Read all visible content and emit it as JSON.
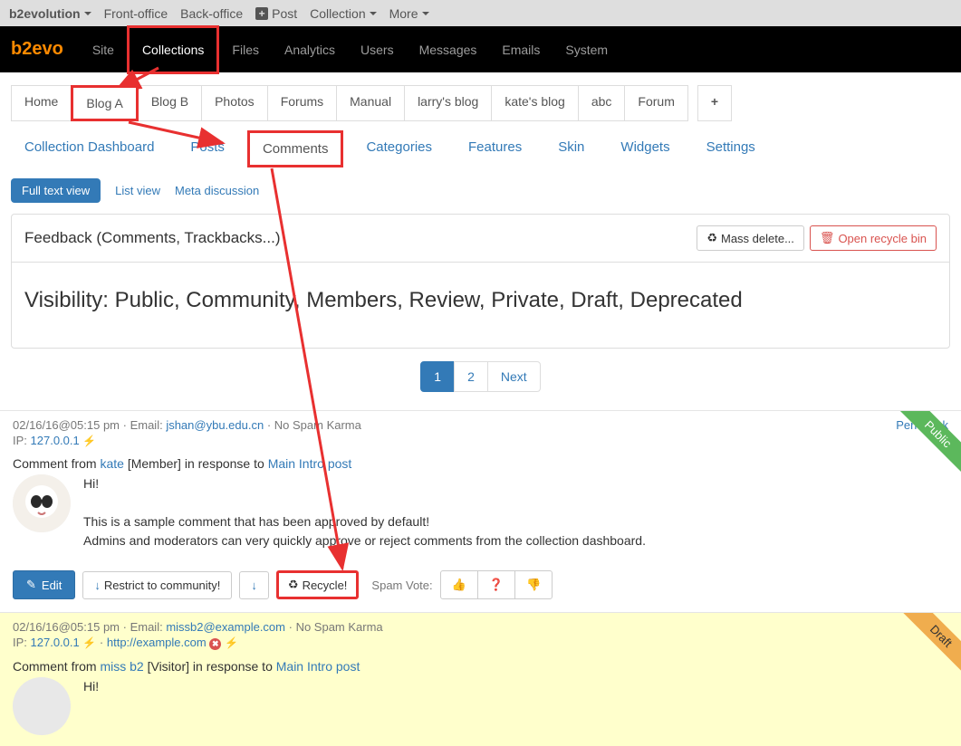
{
  "topbar": {
    "brand": "b2evolution",
    "items": [
      "Front-office",
      "Back-office"
    ],
    "post": "Post",
    "collection": "Collection",
    "more": "More"
  },
  "nav": {
    "brand": "b2evo",
    "items": [
      "Site",
      "Collections",
      "Files",
      "Analytics",
      "Users",
      "Messages",
      "Emails",
      "System"
    ],
    "active_index": 1
  },
  "blogtabs": [
    "Home",
    "Blog A",
    "Blog B",
    "Photos",
    "Forums",
    "Manual",
    "larry's blog",
    "kate's blog",
    "abc",
    "Forum"
  ],
  "blogtab_highlight_index": 1,
  "subtabs": [
    "Collection Dashboard",
    "Posts",
    "Comments",
    "Categories",
    "Features",
    "Skin",
    "Widgets",
    "Settings"
  ],
  "subtab_active_index": 2,
  "viewtabs": {
    "active": "Full text view",
    "links": [
      "List view",
      "Meta discussion"
    ]
  },
  "panel": {
    "title": "Feedback (Comments, Trackbacks...)",
    "mass_delete": "Mass delete...",
    "open_recycle": "Open recycle bin",
    "visibility": "Visibility: Public, Community, Members, Review, Private, Draft, Deprecated"
  },
  "pagination": {
    "pages": [
      "1",
      "2"
    ],
    "next": "Next",
    "active_index": 0
  },
  "comments": [
    {
      "datetime": "02/16/16@05:15 pm",
      "email_label": "Email: ",
      "email": "jshan@ybu.edu.cn",
      "karma": "No Spam Karma",
      "permalink": "Permalink",
      "ip_label": "IP: ",
      "ip": "127.0.0.1",
      "url": "",
      "from_prefix": "Comment from ",
      "author": "kate",
      "role": " [Member] in response to ",
      "post": "Main Intro post",
      "hi": "Hi!",
      "line1": "This is a sample comment that has been approved by default!",
      "line2": "Admins and moderators can very quickly approve or reject comments from the collection dashboard.",
      "status": "Public",
      "actions": {
        "edit": "Edit",
        "restrict": "Restrict to community!",
        "recycle": "Recycle!",
        "spam_label": "Spam Vote:"
      }
    },
    {
      "datetime": "02/16/16@05:15 pm",
      "email_label": "Email: ",
      "email": "missb2@example.com",
      "karma": "No Spam Karma",
      "permalink": "",
      "ip_label": "IP: ",
      "ip": "127.0.0.1",
      "url": "http://example.com",
      "from_prefix": "Comment from ",
      "author": "miss b2",
      "role": " [Visitor] in response to ",
      "post": "Main Intro post",
      "hi": "Hi!",
      "status": "Draft"
    }
  ]
}
